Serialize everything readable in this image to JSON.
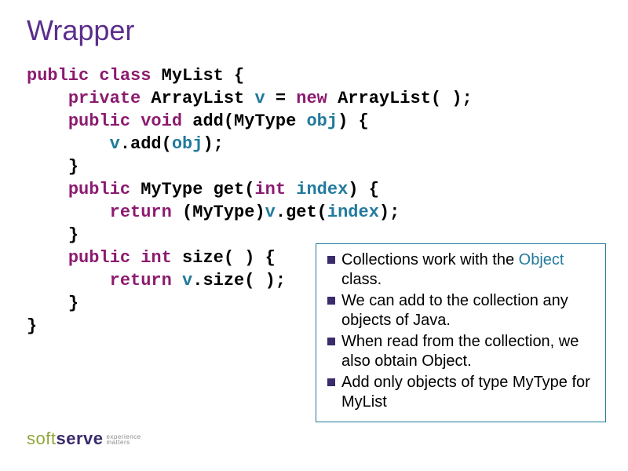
{
  "title": "Wrapper",
  "code": {
    "l1_kw1": "public class",
    "l1_txt1": " MyList {",
    "l2_kw1": "private",
    "l2_txt1": " ArrayList ",
    "l2_var1": "v",
    "l2_txt2": " = ",
    "l2_kw2": "new",
    "l2_txt3": " ArrayList( );",
    "l3_kw1": "public void",
    "l3_txt1": " add(MyType ",
    "l3_var1": "obj",
    "l3_txt2": ") {",
    "l4_var1": "v",
    "l4_txt1": ".add(",
    "l4_var2": "obj",
    "l4_txt2": ");",
    "l5_txt1": "}",
    "l6_kw1": "public",
    "l6_txt1": " MyType get(",
    "l6_kw2": "int",
    "l6_txt2": " ",
    "l6_var1": "index",
    "l6_txt3": ") {",
    "l7_kw1": "return",
    "l7_txt1": " (MyType)",
    "l7_var1": "v",
    "l7_txt2": ".get(",
    "l7_var2": "index",
    "l7_txt3": ");",
    "l8_txt1": "}",
    "l9_kw1": "public int",
    "l9_txt1": " size( ) {",
    "l10_kw1": "return",
    "l10_txt1": " ",
    "l10_var1": "v",
    "l10_txt2": ".size( );",
    "l11_txt1": "}",
    "l12_txt1": "}"
  },
  "callout": {
    "b1a": "Collections work with the ",
    "b1obj": "Object",
    "b1b": " class.",
    "b2": "We can add to the collection any objects of Java.",
    "b3": "When read from the collection, we also obtain Object.",
    "b4": "Add only objects of type MyType for MyList"
  },
  "logo": {
    "soft": "soft",
    "serve": "serve",
    "tag1": "experience",
    "tag2": "matters"
  }
}
